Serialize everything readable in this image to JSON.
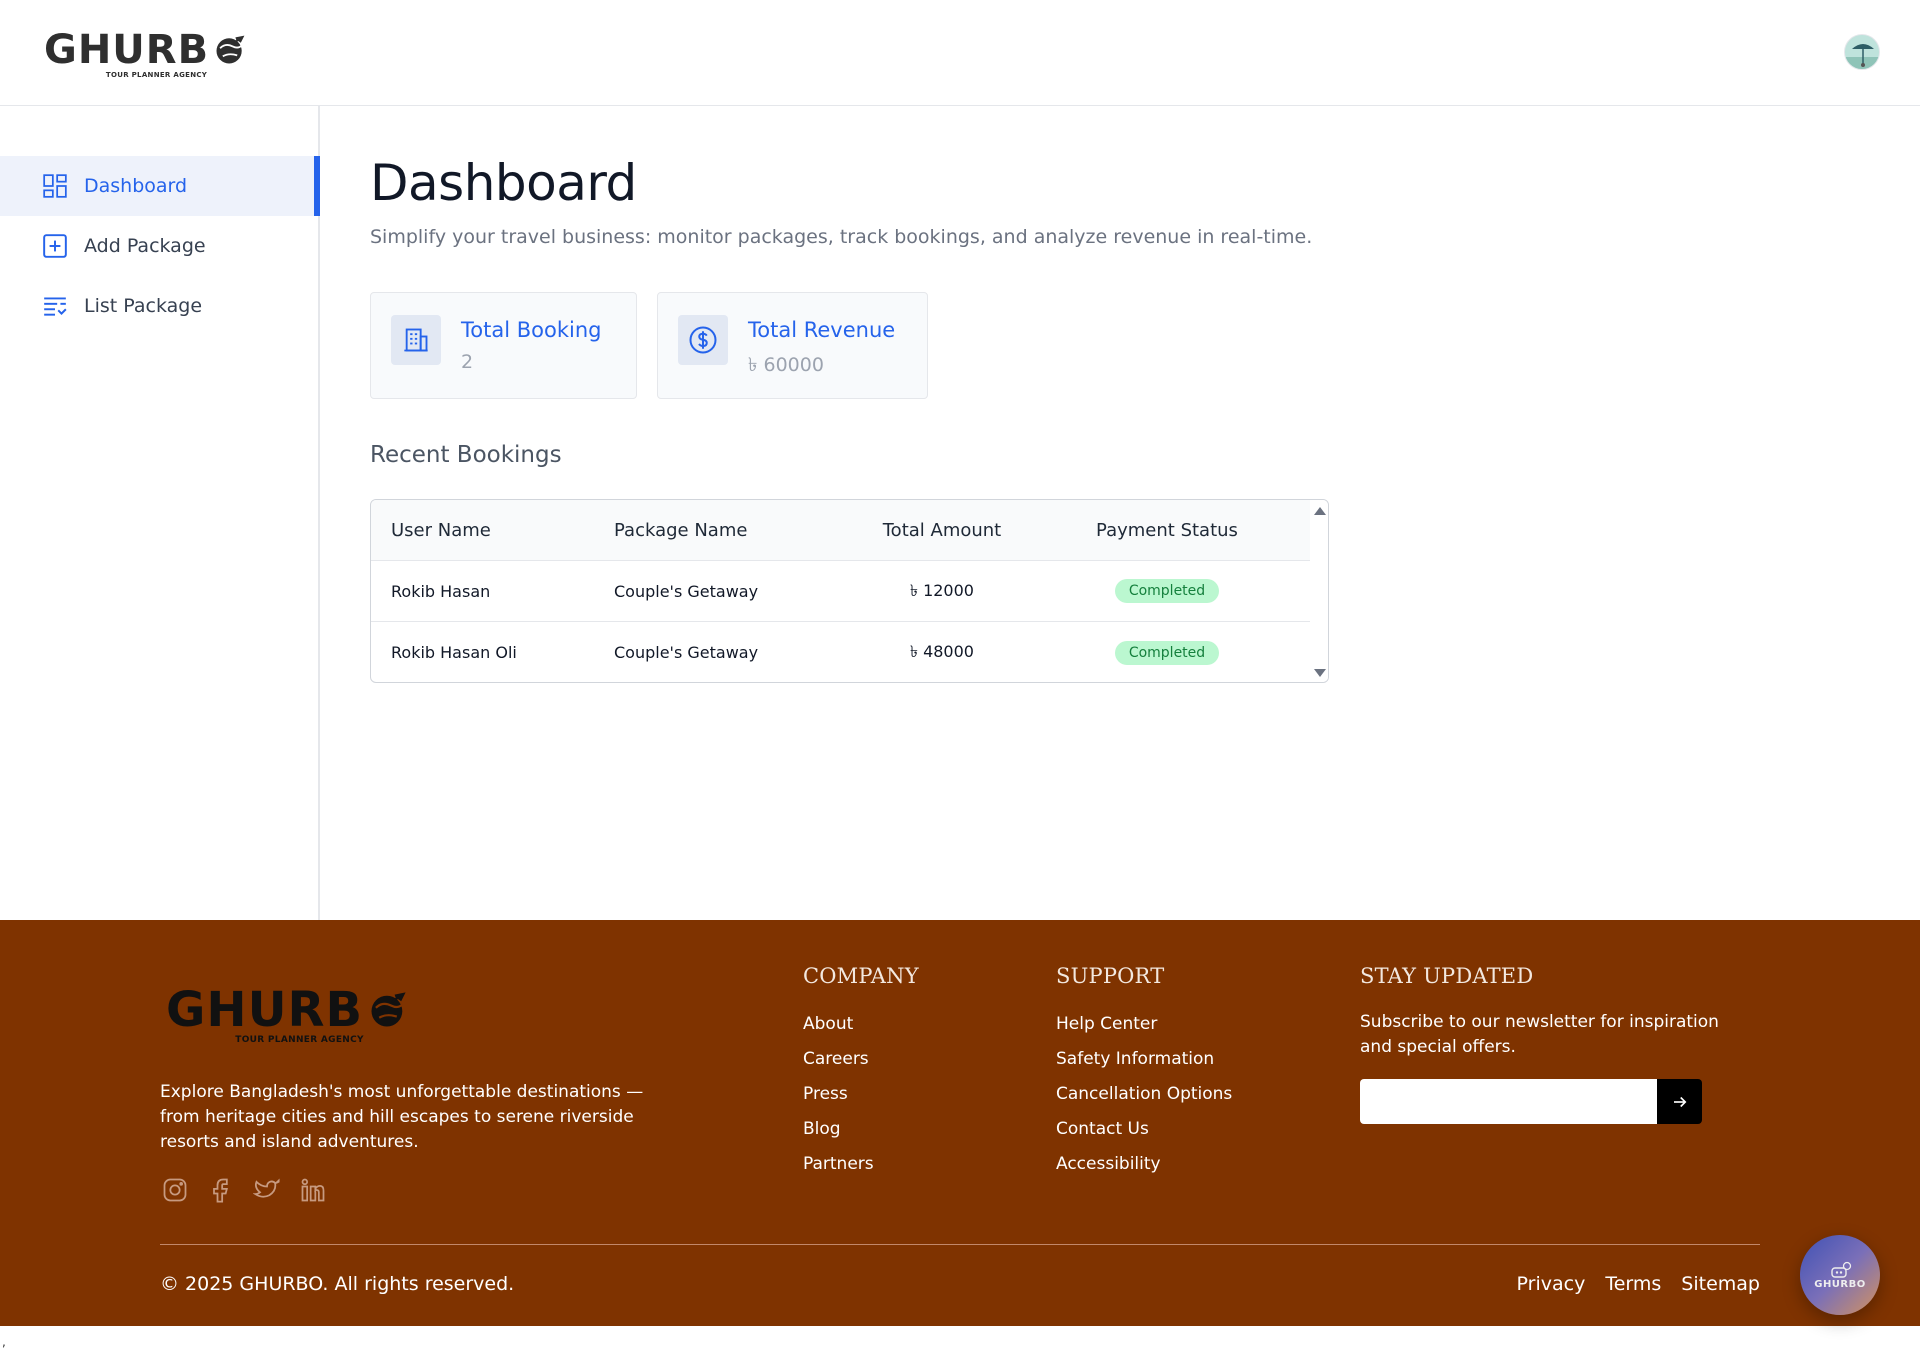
{
  "brand": {
    "name": "GHURB",
    "tagline": "TOUR PLANNER AGENCY"
  },
  "header": {
    "avatar_icon": "user-avatar"
  },
  "sidebar": {
    "items": [
      {
        "label": "Dashboard",
        "icon": "dashboard-icon",
        "active": true
      },
      {
        "label": "Add Package",
        "icon": "plus-square-icon",
        "active": false
      },
      {
        "label": "List Package",
        "icon": "list-icon",
        "active": false
      }
    ]
  },
  "main": {
    "title": "Dashboard",
    "description": "Simplify your travel business: monitor packages, track bookings, and analyze revenue in real-time.",
    "stats": [
      {
        "label": "Total Booking",
        "value": "2",
        "icon": "building-icon"
      },
      {
        "label": "Total Revenue",
        "value": "৳ 60000",
        "icon": "dollar-circle-icon"
      }
    ],
    "recent_title": "Recent Bookings",
    "table": {
      "headers": [
        "User Name",
        "Package Name",
        "Total Amount",
        "Payment Status"
      ],
      "rows": [
        {
          "user": "Rokib Hasan",
          "package": "Couple's Getaway",
          "amount": "৳ 12000",
          "status": "Completed"
        },
        {
          "user": "Rokib Hasan Oli",
          "package": "Couple's Getaway",
          "amount": "৳ 48000",
          "status": "Completed"
        }
      ]
    }
  },
  "footer": {
    "about": "Explore Bangladesh's most unforgettable destinations — from heritage cities and hill escapes to serene riverside resorts and island adventures.",
    "social": [
      "instagram-icon",
      "facebook-icon",
      "twitter-icon",
      "linkedin-icon"
    ],
    "company": {
      "title": "COMPANY",
      "links": [
        "About",
        "Careers",
        "Press",
        "Blog",
        "Partners"
      ]
    },
    "support": {
      "title": "SUPPORT",
      "links": [
        "Help Center",
        "Safety Information",
        "Cancellation Options",
        "Contact Us",
        "Accessibility"
      ]
    },
    "newsletter": {
      "title": "STAY UPDATED",
      "text": "Subscribe to our newsletter for inspiration and special offers.",
      "placeholder": ""
    },
    "copyright": "© 2025 GHURBO. All rights reserved.",
    "legal": [
      "Privacy",
      "Terms",
      "Sitemap"
    ]
  },
  "chat_widget": {
    "label": "GHURBO"
  },
  "stray_text": ","
}
